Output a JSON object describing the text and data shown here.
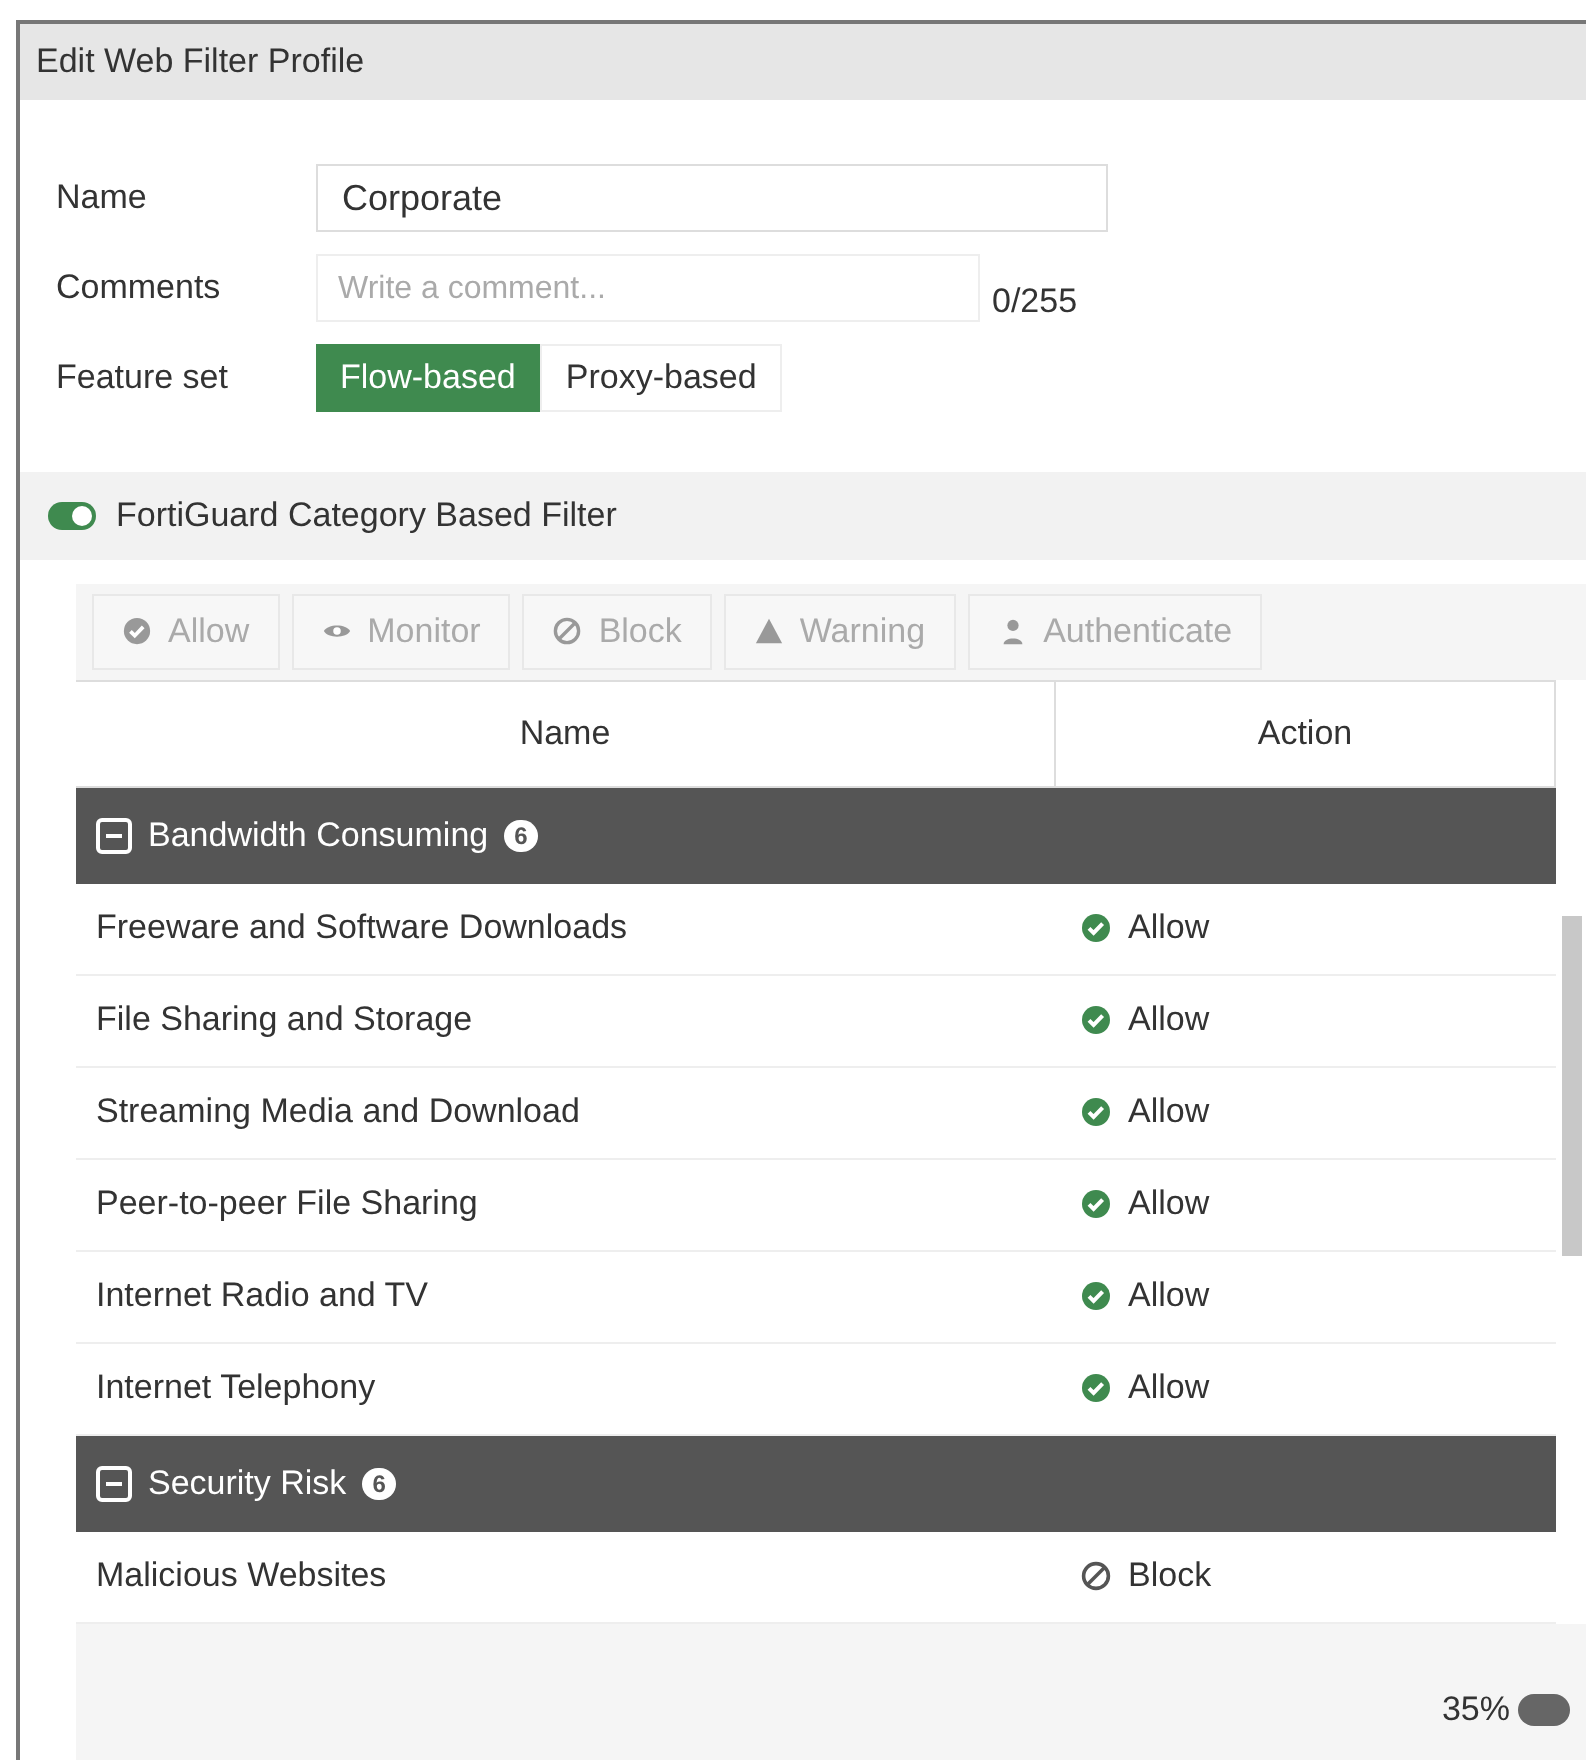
{
  "window": {
    "title": "Edit Web Filter Profile"
  },
  "form": {
    "name": {
      "label": "Name",
      "value": "Corporate"
    },
    "comments": {
      "label": "Comments",
      "placeholder": "Write a comment...",
      "counter": "0/255"
    },
    "feature_set": {
      "label": "Feature set",
      "options": [
        {
          "label": "Flow-based",
          "selected": true
        },
        {
          "label": "Proxy-based",
          "selected": false
        }
      ]
    }
  },
  "filter_toggle": {
    "label": "FortiGuard Category Based Filter",
    "on": true
  },
  "toolbar": [
    {
      "label": "Allow",
      "kind": "allow",
      "disabled": true
    },
    {
      "label": "Monitor",
      "kind": "monitor",
      "disabled": true
    },
    {
      "label": "Block",
      "kind": "block",
      "disabled": true
    },
    {
      "label": "Warning",
      "kind": "warning",
      "disabled": true
    },
    {
      "label": "Authenticate",
      "kind": "authenticate",
      "disabled": true
    }
  ],
  "table": {
    "columns": [
      "Name",
      "Action"
    ],
    "groups": [
      {
        "name": "Bandwidth Consuming",
        "count": "6",
        "expanded": true,
        "rows": [
          {
            "name": "Freeware and Software Downloads",
            "action": "Allow",
            "kind": "allow"
          },
          {
            "name": "File Sharing and Storage",
            "action": "Allow",
            "kind": "allow"
          },
          {
            "name": "Streaming Media and Download",
            "action": "Allow",
            "kind": "allow"
          },
          {
            "name": "Peer-to-peer File Sharing",
            "action": "Allow",
            "kind": "allow"
          },
          {
            "name": "Internet Radio and TV",
            "action": "Allow",
            "kind": "allow"
          },
          {
            "name": "Internet Telephony",
            "action": "Allow",
            "kind": "allow"
          }
        ]
      },
      {
        "name": "Security Risk",
        "count": "6",
        "expanded": true,
        "rows": [
          {
            "name": "Malicious Websites",
            "action": "Block",
            "kind": "block"
          }
        ]
      }
    ]
  },
  "footer": {
    "percent": "35%"
  }
}
